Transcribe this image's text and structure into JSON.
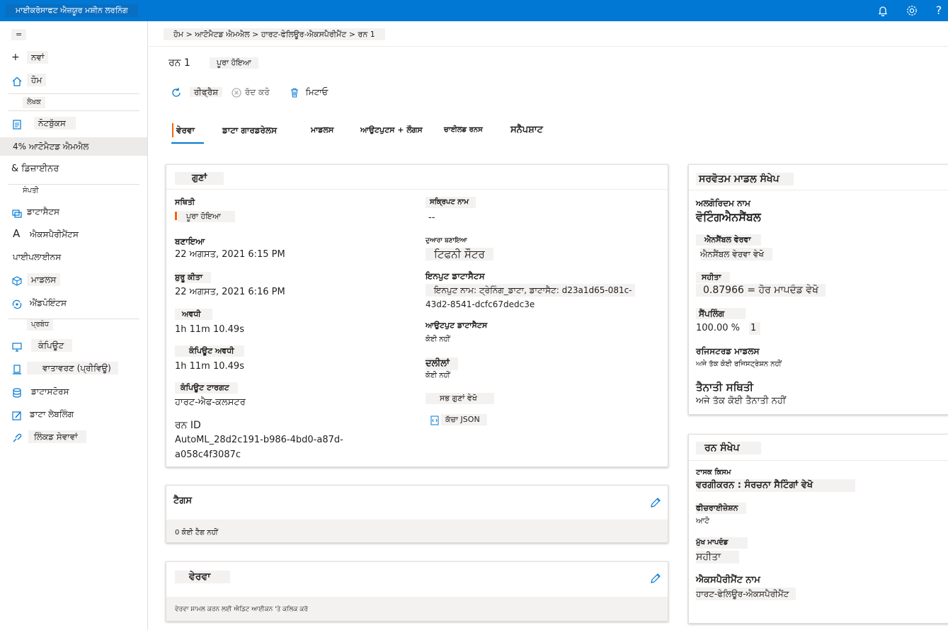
{
  "app": {
    "title": "ਮਾਈਕਰੋਸਾਫਟ ਐਜ਼ਯੂਰ ਮਸ਼ੀਨ ਲਰਨਿੰਗ"
  },
  "colors": {
    "accent": "#0078d4",
    "topbar": "#0078d4"
  },
  "sidebar": {
    "collapse_glyph": "=",
    "new": "ਨਵਾਂ",
    "home": "ਹੋਮ",
    "section_author": "ਲੇਖਕ",
    "notebooks": "ਨੋਟਬੁੱਕਸ",
    "automl": "4% ਆਟੋਮੈਟਡ ਐਮਐਲ",
    "designer": "& ਡਿਜ਼ਾਈਨਰ",
    "section_assets": "ਸੰਪਤੀ",
    "datasets": "ਡਾਟਾਸੈਟਸ",
    "experiments_glyph": "A",
    "experiments": "ਐਕਸਪੈਰੀਮੈਂਟਸ",
    "pipelines": "ਪਾਈਪਲਾਈਨਸ",
    "models": "ਮਾਡਲਸ",
    "endpoints": "ਐਂਡਪੋਇੰਟਸ",
    "section_manage": "ਪ੍ਰਬੰਧ",
    "compute": "ਕੰਪਿਊਟ",
    "environments": "ਵਾਤਾਵਰਣ (ਪ੍ਰੀਵਿਊ)",
    "datastores": "ਡਾਟਾਸਟੋਰਸ",
    "labeling": "ਡਾਟਾ ਲੇਬਲਿੰਗ",
    "linked": "ਲਿੰਕਡ ਸੇਵਾਵਾਂ"
  },
  "breadcrumb": "ਹੋਮ > ਆਟੋਮੈਟਡ ਐਮਐਲ > ਹਾਰਟ-ਫੇਲਿਊਰ-ਐਕਸਪੈਰੀਮੈਂਟ > ਰਨ 1",
  "run": {
    "name": "ਰਨ 1",
    "status": "ਪੂਰਾ ਹੋਇਆ"
  },
  "commands": {
    "refresh": "ਰੀਫ੍ਰੈਸ਼",
    "cancel": "ਰੱਦ ਕਰੋ",
    "delete": "ਮਿਟਾਓ"
  },
  "tabs": [
    "ਵੇਰਵਾ",
    "ਡਾਟਾ ਗਾਰਡਰੇਲਸ",
    "ਮਾਡਲਸ",
    "ਆਉਟਪੁਟਸ + ਲੌਗਸ",
    "ਚਾਈਲਡ ਰਨਸ",
    "ਸਨੈਪਸ਼ਾਟ"
  ],
  "properties": {
    "title": "ਗੁਣਾਂ",
    "status_label": "ਸਥਿਤੀ",
    "status_value": "ਪੂਰਾ ਹੋਇਆ",
    "created_label": "ਬਣਾਇਆ",
    "created_value": "22 ਅਗਸਤ, 2021 6:15 PM",
    "started_label": "ਸ਼ੁਰੂ ਕੀਤਾ",
    "started_value": "22 ਅਗਸਤ, 2021 6:16 PM",
    "duration_label": "ਅਵਧੀ",
    "duration_value": "1h 11m 10.49s",
    "compute_duration_label": "ਕੰਪਿਊਟ ਅਵਧੀ",
    "compute_duration_value": "1h 11m 10.49s",
    "compute_target_label": "ਕੰਪਿਊਟ ਟਾਰਗਟ",
    "compute_target_value": "ਹਾਰਟ-ਐਫ-ਕਲਸਟਰ",
    "run_id_label": "ਰਨ ID",
    "run_id_line1": "AutoML_28d2c191-b986-4bd0-a87d-",
    "run_id_line2": "a058c4f3087c",
    "script_label": "ਸਕ੍ਰਿਪਟ ਨਾਮ",
    "script_value": "--",
    "created_by_label": "ਦੁਆਰਾ ਬਣਾਇਆ",
    "created_by_value": "ਟਿਫਨੀ ਸੌਟਰ",
    "input_label": "ਇਨਪੁਟ ਡਾਟਾਸੈਟਸ",
    "input_line1": "ਇਨਪੁਟ ਨਾਮ: ਟ੍ਰੇਨਿੰਗ_ਡਾਟਾ, ਡਾਟਾਸੈਟ: d23a1d65-081c-",
    "input_line2": "43d2-8541-dcfc67dedc3e",
    "output_label": "ਆਉਟਪੁਟ ਡਾਟਾਸੈਟਸ",
    "output_value": "ਕੋਈ ਨਹੀਂ",
    "args_label": "ਦਲੀਲਾਂ",
    "args_value": "ਕੋਈ ਨਹੀਂ",
    "see_all": "ਸਭ ਗੁਣਾਂ ਵੇਖੋ",
    "raw_json": "ਕੱਚਾ JSON"
  },
  "tags": {
    "title": "ਟੈਗਸ",
    "empty": "0 ਕੋਈ ਟੈਗ ਨਹੀਂ"
  },
  "description": {
    "title": "ਵੇਰਵਾ",
    "hint": "ਵੇਰਵਾ ਸ਼ਾਮਲ ਕਰਨ ਲਈ ਐਡਿਟ ਆਈਕਨ 'ਤੇ ਕਲਿਕ ਕਰੋ"
  },
  "best_model": {
    "title": "ਸਰਵੋਤਮ ਮਾਡਲ ਸੰਖੇਪ",
    "algo_label": "ਅਲਗੋਰਿਦਮ ਨਾਮ",
    "algo_value": "ਵੋਟਿੰਗਐਨਸੈਂਬਲ",
    "ensemble_label": "ਐਨਸੈਂਬਲ ਵੇਰਵਾ",
    "ensemble_link": "ਐਨਸੈਂਬਲ ਵੇਰਵਾ ਵੇਖੋ",
    "accuracy_label": "ਸਹੀਤਾ",
    "accuracy_value": "0.87966 = ਹੋਰ ਮਾਪਦੰਡ ਵੇਖੋ",
    "sampling_label": "ਸੈਂਪਲਿੰਗ",
    "sampling_value": "100.00 %",
    "sampling_suffix": "1",
    "registered_label": "ਰਜਿਸਟਰਡ ਮਾਡਲਸ",
    "registered_value": "ਅਜੇ ਤੱਕ ਕੋਈ ਰਜਿਸਟ੍ਰੇਸ਼ਨ ਨਹੀਂ",
    "deploy_label": "ਤੈਨਾਤੀ ਸਥਿਤੀ",
    "deploy_value": "ਅਜੇ ਤੱਕ ਕੋਈ ਤੈਨਾਤੀ ਨਹੀਂ"
  },
  "run_summary": {
    "title": "ਰਨ ਸੰਖੇਪ",
    "task_label": "ਟਾਸਕ ਕਿਸਮ",
    "task_value": "ਵਰਗੀਕਰਨ : ਸੰਰਚਨਾ ਸੈਟਿੰਗਾਂ ਵੇਖੋ",
    "feat_label": "ਫੀਚਰਾਈਜ਼ੇਸ਼ਨ",
    "feat_value": "ਆਟੋ",
    "metric_label": "ਮੁੱਖ ਮਾਪਦੰਡ",
    "metric_value": "ਸਹੀਤਾ",
    "exp_label": "ਐਕਸਪੈਰੀਮੈਂਟ ਨਾਮ",
    "exp_value": "ਹਾਰਟ-ਫੇਲਿਊਰ-ਐਕਸਪੈਰੀਮੈਂਟ"
  }
}
